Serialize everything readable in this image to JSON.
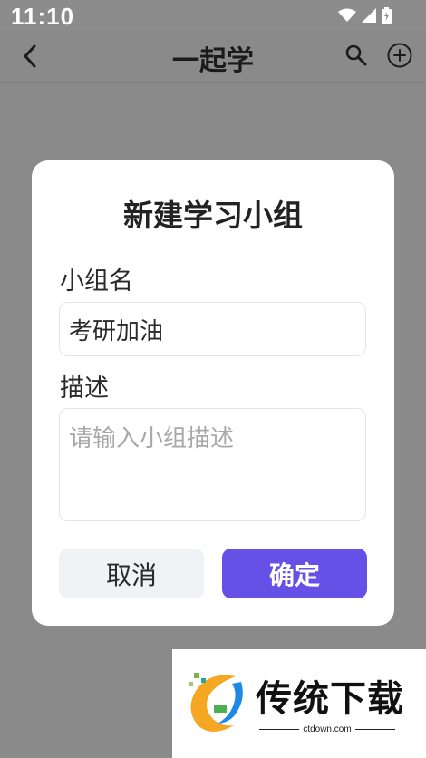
{
  "status_bar": {
    "time": "11:10"
  },
  "app_bar": {
    "title": "一起学"
  },
  "dialog": {
    "title": "新建学习小组",
    "name_label": "小组名",
    "name_value": "考研加油",
    "desc_label": "描述",
    "desc_placeholder": "请输入小组描述",
    "desc_value": "",
    "cancel_label": "取消",
    "confirm_label": "确定"
  },
  "watermark": {
    "brand": "传统下载",
    "url": "ctdown.com"
  },
  "colors": {
    "accent": "#6650e6",
    "scrim": "#8a8a8a",
    "cancel_bg": "#f1f2f6"
  },
  "icons": [
    "wifi-icon",
    "signal-icon",
    "battery-icon",
    "back-arrow-icon",
    "search-icon",
    "add-circle-icon"
  ]
}
